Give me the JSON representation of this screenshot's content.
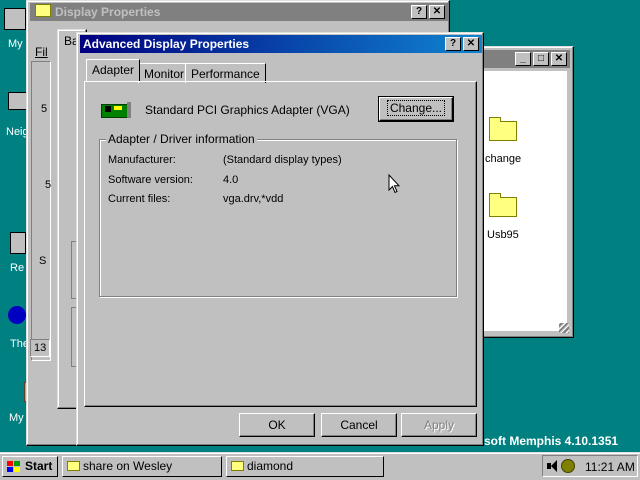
{
  "desktop": {
    "icons": [
      "My",
      "Neig",
      "Re",
      "The",
      "My Brief"
    ],
    "watermark": "soft Memphis 4.10.1351"
  },
  "display_props": {
    "title": "Display Properties",
    "partial_tab": "Ba",
    "side_chars": [
      "5",
      "5",
      "S"
    ],
    "field_value": "13"
  },
  "explorer": {
    "menu_partial": "Fil",
    "folders": [
      "change",
      "Usb95"
    ]
  },
  "dialog": {
    "title": "Advanced Display Properties",
    "tabs": [
      "Adapter",
      "Monitor",
      "Performance"
    ],
    "adapter_name": "Standard PCI Graphics Adapter (VGA)",
    "change_label": "Change...",
    "group_title": "Adapter / Driver information",
    "info": {
      "manufacturer_label": "Manufacturer:",
      "manufacturer_value": "(Standard display types)",
      "version_label": "Software version:",
      "version_value": "4.0",
      "files_label": "Current files:",
      "files_value": "vga.drv,*vdd"
    },
    "buttons": {
      "ok": "OK",
      "cancel": "Cancel",
      "apply": "Apply"
    }
  },
  "taskbar": {
    "start": "Start",
    "tasks": [
      "share on Wesley",
      "diamond"
    ],
    "clock": "11:21 AM"
  }
}
